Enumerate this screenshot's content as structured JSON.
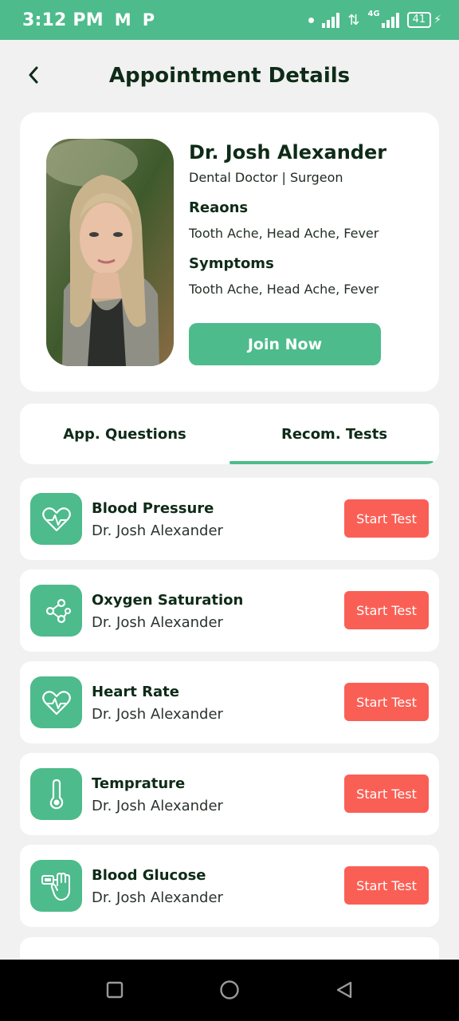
{
  "status_bar": {
    "time": "3:12 PM",
    "app_icons": [
      "M",
      "P"
    ],
    "network_label": "4G",
    "battery": "41"
  },
  "header": {
    "title": "Appointment Details",
    "back_icon": "chevron-left-icon"
  },
  "doctor": {
    "name": "Dr. Josh Alexander",
    "role": "Dental Doctor | Surgeon",
    "reasons_label": "Reaons",
    "reasons": "Tooth Ache, Head Ache, Fever",
    "symptoms_label": "Symptoms",
    "symptoms": "Tooth Ache, Head Ache, Fever",
    "join_label": "Join Now"
  },
  "tabs": [
    {
      "label": "App. Questions",
      "active": false
    },
    {
      "label": "Recom. Tests",
      "active": true
    }
  ],
  "tests": [
    {
      "title": "Blood Pressure",
      "doctor": "Dr. Josh Alexander",
      "button": "Start Test",
      "icon": "heart-pulse-icon"
    },
    {
      "title": "Oxygen Saturation",
      "doctor": "Dr. Josh Alexander",
      "button": "Start Test",
      "icon": "molecule-icon"
    },
    {
      "title": "Heart Rate",
      "doctor": "Dr. Josh Alexander",
      "button": "Start Test",
      "icon": "heart-pulse-icon"
    },
    {
      "title": "Temprature",
      "doctor": "Dr. Josh Alexander",
      "button": "Start Test",
      "icon": "thermometer-icon"
    },
    {
      "title": "Blood Glucose",
      "doctor": "Dr. Josh Alexander",
      "button": "Start Test",
      "icon": "glucose-meter-icon"
    }
  ],
  "colors": {
    "primary": "#4dbb8b",
    "accent": "#fa5f55",
    "background": "#f1f1f1",
    "text": "#0e2b17"
  }
}
